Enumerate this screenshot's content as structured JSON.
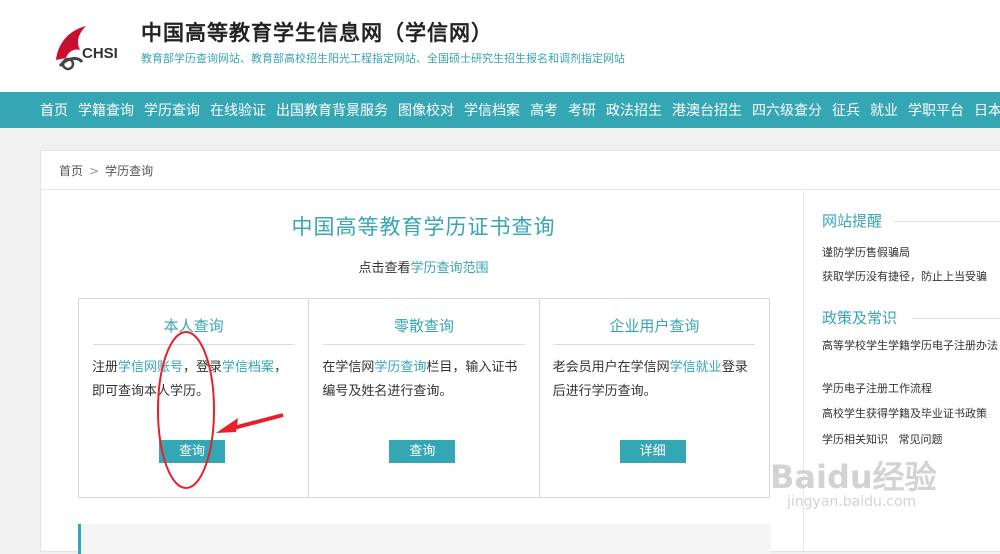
{
  "header": {
    "logo_text": "CHSI",
    "title": "中国高等教育学生信息网（学信网）",
    "subtitle": "教育部学历查询网站、教育部高校招生阳光工程指定网站、全国硕士研究生招生报名和调剂指定网站"
  },
  "nav": [
    "首页",
    "学籍查询",
    "学历查询",
    "在线验证",
    "出国教育背景服务",
    "图像校对",
    "学信档案",
    "高考",
    "考研",
    "政法招生",
    "港澳台招生",
    "四六级查分",
    "征兵",
    "就业",
    "学职平台",
    "日本频"
  ],
  "breadcrumb": {
    "home": "首页",
    "sep": ">",
    "current": "学历查询"
  },
  "main": {
    "title": "中国高等教育学历证书查询",
    "scope_prefix": "点击查看",
    "scope_link": "学历查询范围"
  },
  "boxes": [
    {
      "title": "本人查询",
      "desc": [
        {
          "t": "注册",
          "hl": false
        },
        {
          "t": "学信网账号",
          "hl": true
        },
        {
          "t": "，登录",
          "hl": false
        },
        {
          "t": "学信档案",
          "hl": true
        },
        {
          "t": "，即可查询本人学历。",
          "hl": false
        }
      ],
      "button": "查询"
    },
    {
      "title": "零散查询",
      "desc": [
        {
          "t": "在学信网",
          "hl": false
        },
        {
          "t": "学历查询",
          "hl": true
        },
        {
          "t": "栏目，输入证书编号及姓名进行查询。",
          "hl": false
        }
      ],
      "button": "查询"
    },
    {
      "title": "企业用户查询",
      "desc": [
        {
          "t": "老会员用户在学信网",
          "hl": false
        },
        {
          "t": "学信就业",
          "hl": true
        },
        {
          "t": "登录后进行学历查询。",
          "hl": false
        }
      ],
      "button": "详细"
    }
  ],
  "sidebar": {
    "notice_title": "网站提醒",
    "notices": [
      "谨防学历售假骗局",
      "获取学历没有捷径，防止上当受骗"
    ],
    "policy_title": "政策及常识",
    "policies": [
      "高等学校学生学籍学历电子注册办法",
      "学历电子注册工作流程",
      "高校学生获得学籍及毕业证书政策",
      "学历相关知识   常见问题"
    ]
  },
  "watermark": {
    "main": "Baidu经验",
    "sub": "jingyan.baidu.com"
  },
  "colors": {
    "accent": "#35a6b4",
    "annotation": "#e8202a"
  }
}
